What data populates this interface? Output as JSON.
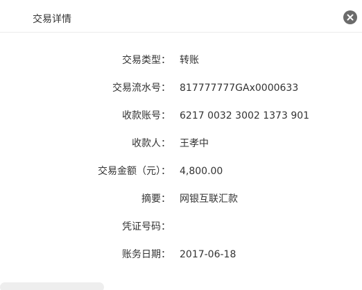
{
  "dialog": {
    "title": "交易详情",
    "close_icon": "close-icon"
  },
  "details": [
    {
      "label": "交易类型：",
      "value": "转账"
    },
    {
      "label": "交易流水号：",
      "value": "817777777GAx0000633"
    },
    {
      "label": "收款账号：",
      "value": "6217 0032 3002 1373 901"
    },
    {
      "label": "收款人：",
      "value": "王孝中"
    },
    {
      "label": "交易金额（元）：",
      "value": "4,800.00"
    },
    {
      "label": "摘要：",
      "value": "网银互联汇款"
    },
    {
      "label": "凭证号码：",
      "value": ""
    },
    {
      "label": "账务日期：",
      "value": "2017-06-18"
    }
  ]
}
